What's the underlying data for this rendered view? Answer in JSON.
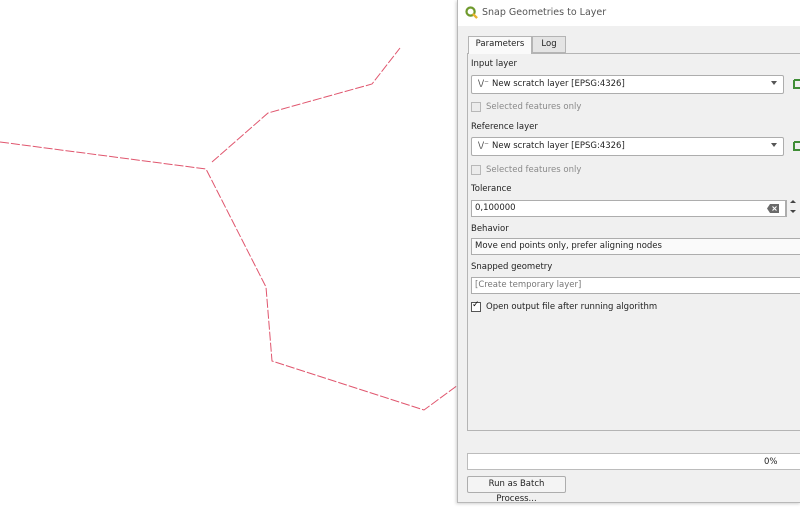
{
  "dialog": {
    "title": "Snap Geometries to Layer",
    "tabs": [
      {
        "label": "Parameters",
        "active": true
      },
      {
        "label": "Log",
        "active": false
      }
    ],
    "input_layer": {
      "label": "Input layer",
      "value": "New scratch layer [EPSG:4326]",
      "selected_only_label": "Selected features only",
      "selected_only_checked": false
    },
    "reference_layer": {
      "label": "Reference layer",
      "value": "New scratch layer [EPSG:4326]",
      "selected_only_label": "Selected features only",
      "selected_only_checked": false
    },
    "tolerance": {
      "label": "Tolerance",
      "value": "0,100000"
    },
    "behavior": {
      "label": "Behavior",
      "value": "Move end points only, prefer aligning nodes"
    },
    "snapped_geometry": {
      "label": "Snapped geometry",
      "placeholder": "[Create temporary layer]"
    },
    "open_output": {
      "label": "Open output file after running algorithm",
      "checked": true
    },
    "progress": {
      "value": 0,
      "text": "0%"
    },
    "batch_button_label": "Run as Batch Process..."
  },
  "colors": {
    "line_feature": "#e0566e",
    "qgis_logo": "#6f9a2d"
  }
}
